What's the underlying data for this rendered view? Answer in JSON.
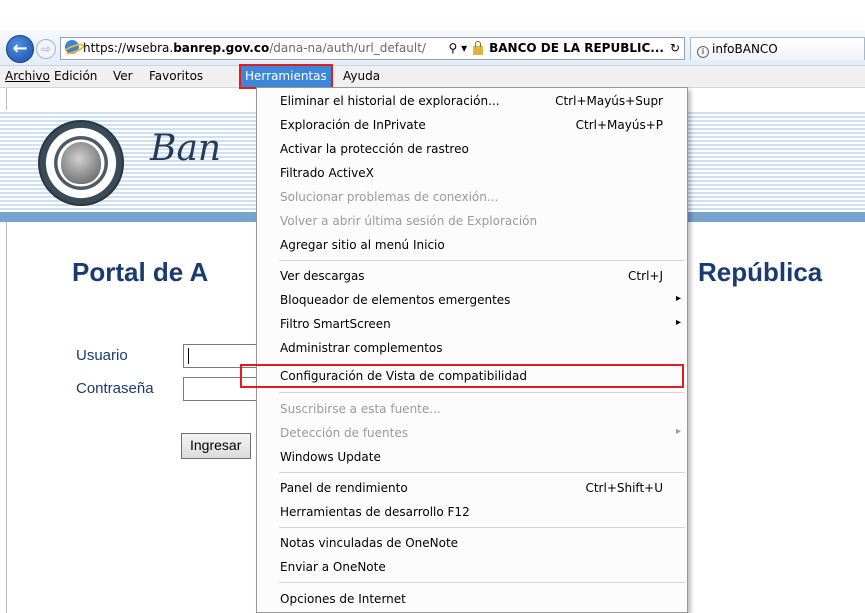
{
  "browser": {
    "url_scheme": "https://wsebra.",
    "url_host": "banrep.gov.co",
    "url_path": "/dana-na/auth/url_default/",
    "url_search_glyph": "⚲ ▾",
    "site_identity": "BANCO DE LA REPUBLIC...",
    "refresh_glyph": "↻",
    "tab_title": "infoBANCO",
    "back_glyph": "←",
    "forward_glyph": "⇨"
  },
  "menubar": {
    "items": [
      "Archivo",
      "Edición",
      "Ver",
      "Favoritos",
      "Herramientas",
      "Ayuda"
    ]
  },
  "page": {
    "banner_text": "Ban",
    "title_left": "Portal de A",
    "title_right": "República",
    "user_label": "Usuario",
    "password_label": "Contraseña",
    "login_button": "Ingresar"
  },
  "tools_menu": {
    "items": [
      {
        "label": "Eliminar el historial de exploración...",
        "shortcut": "Ctrl+Mayús+Supr"
      },
      {
        "label": "Exploración de InPrivate",
        "shortcut": "Ctrl+Mayús+P"
      },
      {
        "label": "Activar la protección de rastreo",
        "shortcut": ""
      },
      {
        "label": "Filtrado ActiveX",
        "shortcut": ""
      },
      {
        "label": "Solucionar problemas de conexión...",
        "shortcut": ""
      },
      {
        "label": "Volver a abrir última sesión de Exploración",
        "shortcut": ""
      },
      {
        "label": "Agregar sitio al menú Inicio",
        "shortcut": ""
      },
      {
        "label": "Ver descargas",
        "shortcut": "Ctrl+J"
      },
      {
        "label": "Bloqueador de elementos emergentes",
        "shortcut": ""
      },
      {
        "label": "Filtro SmartScreen",
        "shortcut": ""
      },
      {
        "label": "Administrar complementos",
        "shortcut": ""
      },
      {
        "label": "Configuración de Vista de compatibilidad",
        "shortcut": ""
      },
      {
        "label": "Suscribirse a esta fuente...",
        "shortcut": ""
      },
      {
        "label": "Detección de fuentes",
        "shortcut": ""
      },
      {
        "label": "Windows Update",
        "shortcut": ""
      },
      {
        "label": "Panel de rendimiento",
        "shortcut": "Ctrl+Shift+U"
      },
      {
        "label": "Herramientas de desarrollo F12",
        "shortcut": ""
      },
      {
        "label": "Notas vinculadas de OneNote",
        "shortcut": ""
      },
      {
        "label": "Enviar a OneNote",
        "shortcut": ""
      },
      {
        "label": "Opciones de Internet",
        "shortcut": ""
      }
    ],
    "submenu_arrow": "▸"
  },
  "colors": {
    "menu_highlight": "#3e86d8",
    "callout_red": "#e31b23",
    "portal_title": "#1a3a72"
  }
}
